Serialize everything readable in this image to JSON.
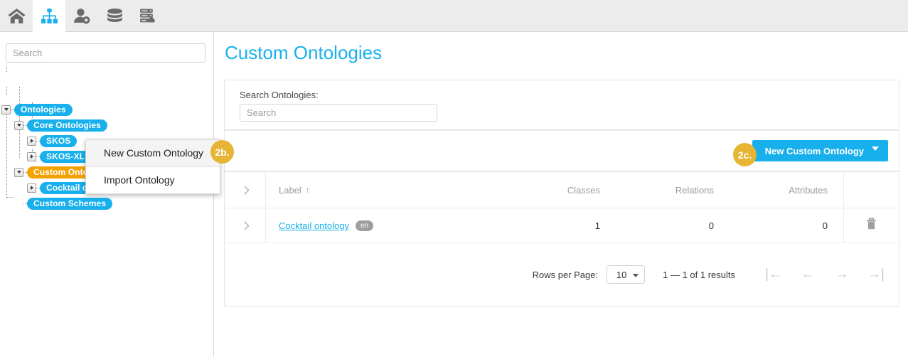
{
  "toolbar": {
    "tabs": [
      {
        "name": "home",
        "icon": "home-icon",
        "active": false
      },
      {
        "name": "ontologies",
        "icon": "hierarchy-icon",
        "active": true
      },
      {
        "name": "users",
        "icon": "user-settings-icon",
        "active": false
      },
      {
        "name": "data",
        "icon": "database-icon",
        "active": false
      },
      {
        "name": "servers",
        "icon": "server-cloud-icon",
        "active": false
      }
    ]
  },
  "sidebar": {
    "search_placeholder": "Search",
    "search_value": "",
    "tree": [
      {
        "label": "Ontologies",
        "depth": 0,
        "state": "expanded",
        "color": "blue"
      },
      {
        "label": "Core Ontologies",
        "depth": 1,
        "state": "expanded",
        "color": "blue"
      },
      {
        "label": "SKOS",
        "depth": 2,
        "state": "collapsed",
        "color": "blue"
      },
      {
        "label": "SKOS-XL",
        "depth": 2,
        "state": "collapsed",
        "color": "blue"
      },
      {
        "label": "Custom Ontologies",
        "depth": 1,
        "state": "expanded",
        "color": "orange"
      },
      {
        "label": "Cocktail ontology",
        "depth": 2,
        "state": "collapsed",
        "color": "blue"
      },
      {
        "label": "Custom Schemes",
        "depth": 1,
        "state": "leaf",
        "color": "blue"
      }
    ]
  },
  "context_menu": {
    "items": [
      {
        "label": "New Custom Ontology",
        "highlighted": true
      },
      {
        "label": "Import Ontology",
        "highlighted": false
      }
    ]
  },
  "badges": {
    "step_2b": "2b.",
    "step_2c": "2c."
  },
  "main": {
    "title": "Custom Ontologies",
    "search_card": {
      "label": "Search Ontologies:",
      "placeholder": "Search",
      "value": ""
    },
    "action_bar": {
      "new_button_label": "New Custom Ontology"
    },
    "table": {
      "columns": [
        "Label",
        "Classes",
        "Relations",
        "Attributes"
      ],
      "sort_column": "Label",
      "sort_direction": "↑",
      "rows": [
        {
          "label": "Cocktail ontology",
          "lang": "en",
          "classes": "1",
          "relations": "0",
          "attributes": "0"
        }
      ]
    },
    "pagination": {
      "rows_per_page_label": "Rows per Page:",
      "rows_per_page_value": "10",
      "results_text": "1 — 1 of 1 results",
      "first_icon": "|←",
      "prev_icon": "←",
      "next_icon": "→",
      "last_icon": "→|"
    }
  },
  "colors": {
    "accent_blue": "#18b0ec",
    "accent_orange": "#f5a200",
    "badge_amber": "#e7b433",
    "toolbar_bg": "#ececec"
  }
}
